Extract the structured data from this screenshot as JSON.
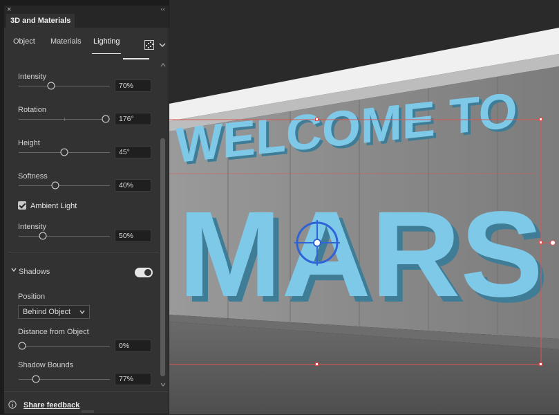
{
  "panel": {
    "title": "3D and Materials",
    "close_glyph": "×",
    "collapse_glyph": "‹‹",
    "tabs": [
      {
        "label": "Object",
        "active": false
      },
      {
        "label": "Materials",
        "active": false
      },
      {
        "label": "Lighting",
        "active": true
      }
    ],
    "render_icon": "render-settings-icon",
    "options_icon": "chevron-down-icon"
  },
  "lighting": {
    "intensity": {
      "label": "Intensity",
      "value": "70%"
    },
    "rotation": {
      "label": "Rotation",
      "value": "176°"
    },
    "height": {
      "label": "Height",
      "value": "45°"
    },
    "softness": {
      "label": "Softness",
      "value": "40%"
    },
    "ambient_light": {
      "label": "Ambient Light",
      "checked": true
    },
    "ambient_intensity": {
      "label": "Intensity",
      "value": "50%"
    }
  },
  "shadows": {
    "section_label": "Shadows",
    "enabled": true,
    "position": {
      "label": "Position",
      "selected": "Behind Object"
    },
    "distance": {
      "label": "Distance from Object",
      "value": "0%"
    },
    "bounds": {
      "label": "Shadow Bounds",
      "value": "77%"
    }
  },
  "footer": {
    "feedback_label": "Share feedback",
    "info_icon": "info-icon"
  },
  "canvas": {
    "text_line1": "WELCOME TO",
    "text_line2": "MARS",
    "text_color": "#7fc9e8",
    "selection_color": "#e05252",
    "light_widget_color": "#2f63d6"
  }
}
